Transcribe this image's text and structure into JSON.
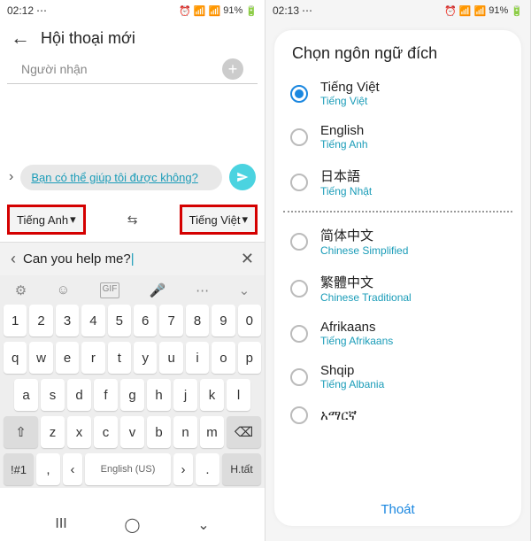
{
  "screen1": {
    "status": {
      "time": "02:12",
      "battery": "91%"
    },
    "header": {
      "title": "Hội thoại mới"
    },
    "recipient": {
      "placeholder": "Người nhận"
    },
    "translated_text": "Bạn có thể giúp tôi được không?",
    "lang_from": "Tiếng Anh",
    "lang_to": "Tiếng Việt",
    "input_text": "Can you help me?",
    "keyboard": {
      "row_num": [
        "1",
        "2",
        "3",
        "4",
        "5",
        "6",
        "7",
        "8",
        "9",
        "0"
      ],
      "row_q": [
        "q",
        "w",
        "e",
        "r",
        "t",
        "y",
        "u",
        "i",
        "o",
        "p"
      ],
      "row_a": [
        "a",
        "s",
        "d",
        "f",
        "g",
        "h",
        "j",
        "k",
        "l"
      ],
      "row_z": [
        "z",
        "x",
        "c",
        "v",
        "b",
        "n",
        "m"
      ],
      "shift": "⇧",
      "backspace": "⌫",
      "numkey": "!#1",
      "comma": ",",
      "space": "English (US)",
      "period": ".",
      "enter": "H.tất"
    }
  },
  "screen2": {
    "status": {
      "time": "02:13",
      "battery": "91%"
    },
    "modal_title": "Chọn ngôn ngữ đích",
    "languages": [
      {
        "native": "Tiếng Việt",
        "sub": "Tiếng Việt",
        "checked": true
      },
      {
        "native": "English",
        "sub": "Tiếng Anh",
        "checked": false
      },
      {
        "native": "日本語",
        "sub": "Tiếng Nhật",
        "checked": false
      },
      {
        "native": "简体中文",
        "sub": "Chinese Simplified",
        "checked": false
      },
      {
        "native": "繁體中文",
        "sub": "Chinese Traditional",
        "checked": false
      },
      {
        "native": "Afrikaans",
        "sub": "Tiếng Afrikaans",
        "checked": false
      },
      {
        "native": "Shqip",
        "sub": "Tiếng Albania",
        "checked": false
      },
      {
        "native": "አማርኛ",
        "sub": "",
        "checked": false
      }
    ],
    "close_label": "Thoát"
  }
}
